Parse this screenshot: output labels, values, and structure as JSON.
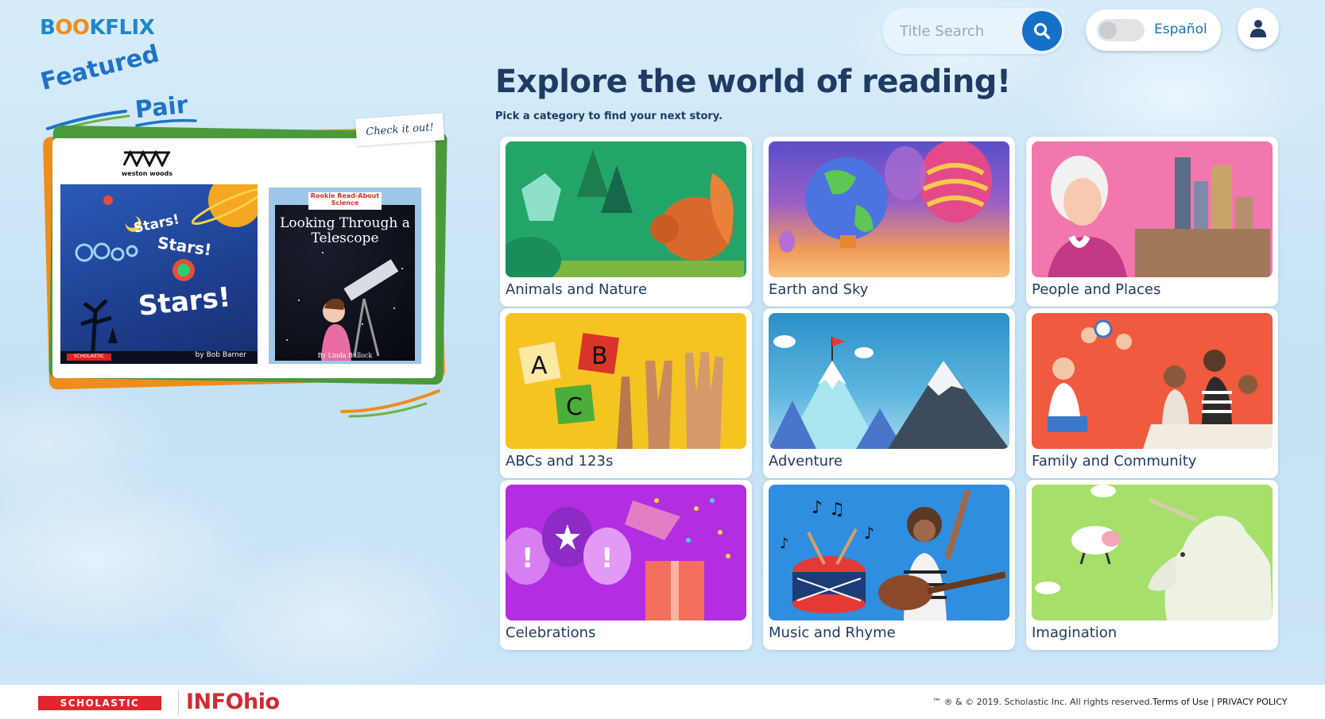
{
  "header": {
    "logo": {
      "p1": "B",
      "p2": "OO",
      "p3": "KFLIX"
    },
    "search": {
      "placeholder": "Title Search"
    },
    "language_toggle": {
      "label": "Español"
    }
  },
  "featured": {
    "title_line1": "Featured",
    "title_line2": "Pair",
    "tag": "Check it out!",
    "publisher": "weston woods",
    "book1": {
      "line1": "Stars!",
      "line2": "Stars!",
      "line3": "Stars!",
      "author": "by Bob Barner",
      "imprint": "SCHOLASTIC"
    },
    "book2": {
      "series": "Rookie Read-About Science",
      "title": "Looking Through a Telescope",
      "author": "By Linda Bullock"
    }
  },
  "main": {
    "headline": "Explore the world of reading!",
    "subline": "Pick a category to find your next story.",
    "categories": [
      {
        "label": "Animals and Nature"
      },
      {
        "label": "Earth and Sky"
      },
      {
        "label": "People and Places"
      },
      {
        "label": "ABCs and 123s"
      },
      {
        "label": "Adventure"
      },
      {
        "label": "Family and Community"
      },
      {
        "label": "Celebrations"
      },
      {
        "label": "Music and Rhyme"
      },
      {
        "label": "Imagination"
      }
    ]
  },
  "footer": {
    "scholastic": "SCHOLASTIC",
    "infohio": "INFOhio",
    "copyright": "™ ® & © 2019. Scholastic Inc. All rights reserved.",
    "terms": "Terms of Use",
    "separator": "|",
    "privacy": "PRIVACY POLICY"
  },
  "colors": {
    "brand_blue": "#1e73c6",
    "brand_orange": "#f08c1c",
    "brand_green": "#6cb33f",
    "headline": "#1f3b63",
    "scholastic_red": "#e0262d"
  }
}
